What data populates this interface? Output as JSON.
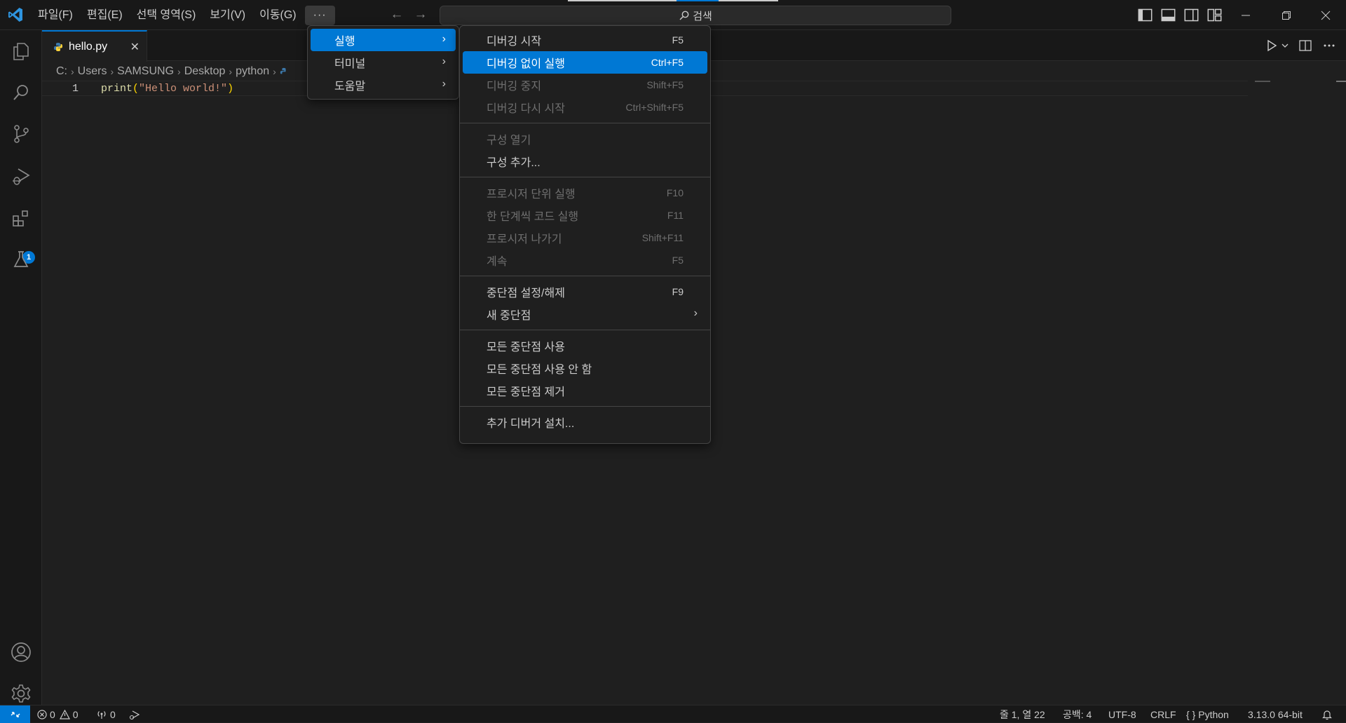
{
  "menubar": {
    "items": [
      "파일(F)",
      "편집(E)",
      "선택 영역(S)",
      "보기(V)",
      "이동(G)"
    ],
    "more_label": "···"
  },
  "search": {
    "label": "검색"
  },
  "tab": {
    "filename": "hello.py",
    "close": "✕"
  },
  "breadcrumb": [
    "C:",
    "Users",
    "SAMSUNG",
    "Desktop",
    "python"
  ],
  "editor": {
    "line_number": "1",
    "code_fn": "print",
    "code_open": "(",
    "code_str": "\"Hello world!\"",
    "code_close": ")"
  },
  "activitybar": {
    "extensions_badge": "1"
  },
  "menu1": {
    "items": [
      {
        "label": "실행",
        "submenu": true,
        "active": true
      },
      {
        "label": "터미널",
        "submenu": true,
        "active": false
      },
      {
        "label": "도움말",
        "submenu": true,
        "active": false
      }
    ]
  },
  "menu2": {
    "items": [
      {
        "label": "디버깅 시작",
        "shortcut": "F5",
        "state": "normal"
      },
      {
        "label": "디버깅 없이 실행",
        "shortcut": "Ctrl+F5",
        "state": "active"
      },
      {
        "label": "디버깅 중지",
        "shortcut": "Shift+F5",
        "state": "disabled"
      },
      {
        "label": "디버깅 다시 시작",
        "shortcut": "Ctrl+Shift+F5",
        "state": "disabled"
      },
      {
        "label": "구성 열기",
        "shortcut": "",
        "state": "disabled"
      },
      {
        "label": "구성 추가...",
        "shortcut": "",
        "state": "normal"
      },
      {
        "label": "프로시저 단위 실행",
        "shortcut": "F10",
        "state": "disabled"
      },
      {
        "label": "한 단계씩 코드 실행",
        "shortcut": "F11",
        "state": "disabled"
      },
      {
        "label": "프로시저 나가기",
        "shortcut": "Shift+F11",
        "state": "disabled"
      },
      {
        "label": "계속",
        "shortcut": "F5",
        "state": "disabled"
      },
      {
        "label": "중단점 설정/해제",
        "shortcut": "F9",
        "state": "normal"
      },
      {
        "label": "새 중단점",
        "shortcut": "",
        "state": "normal",
        "submenu": true
      },
      {
        "label": "모든 중단점 사용",
        "shortcut": "",
        "state": "normal"
      },
      {
        "label": "모든 중단점 사용 안 함",
        "shortcut": "",
        "state": "normal"
      },
      {
        "label": "모든 중단점 제거",
        "shortcut": "",
        "state": "normal"
      },
      {
        "label": "추가 디버거 설치...",
        "shortcut": "",
        "state": "normal"
      }
    ]
  },
  "statusbar": {
    "errors": "0",
    "warnings": "0",
    "ports": "0",
    "position": "줄 1, 열 22",
    "indent": "공백: 4",
    "encoding": "UTF-8",
    "eol": "CRLF",
    "language": "Python",
    "interpreter": "3.13.0 64-bit"
  },
  "colors": {
    "accent": "#0078d4",
    "background": "#1f1f1f",
    "bar": "#181818"
  }
}
